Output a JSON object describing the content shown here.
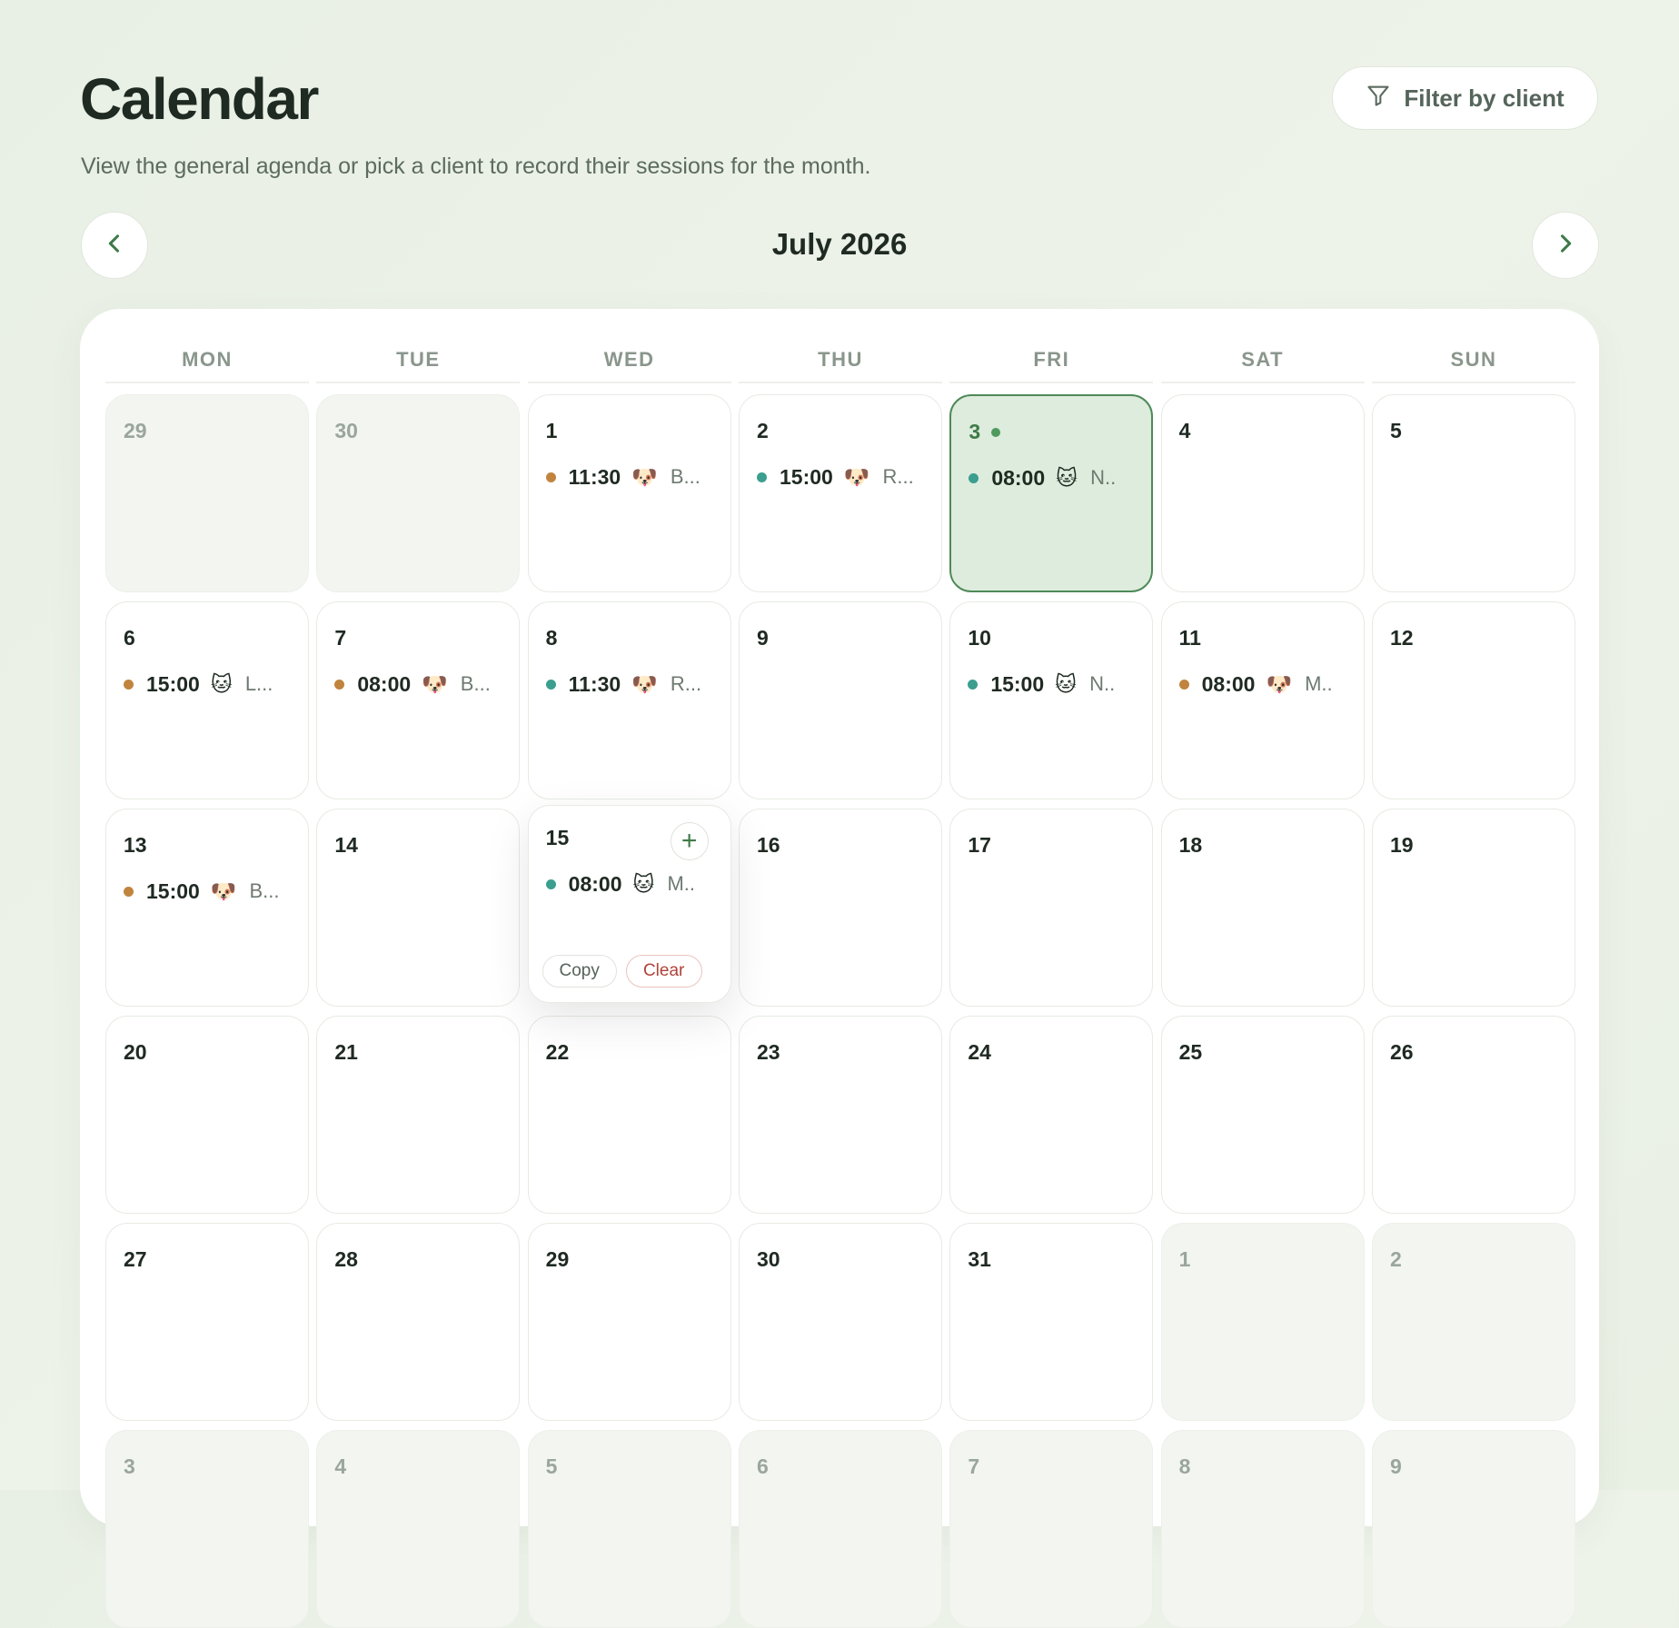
{
  "header": {
    "title": "Calendar",
    "subtitle": "View the general agenda or pick a client to record their sessions for the month.",
    "filter_label": "Filter by client",
    "filter_icon": "filter-funnel-icon"
  },
  "navigation": {
    "month": "July 2026",
    "prev_icon": "chevron-left-icon",
    "next_icon": "chevron-right-icon"
  },
  "colors": {
    "accent": "#4e8a58",
    "today_bg": "#ddecdc",
    "session_amber": "#c0843e",
    "session_teal": "#3b9e8f",
    "clear_red": "#b0433a"
  },
  "weekdays": [
    "MON",
    "TUE",
    "WED",
    "THU",
    "FRI",
    "SAT",
    "SUN"
  ],
  "day_actions": {
    "add": "+",
    "copy": "Copy",
    "clear": "Clear"
  },
  "weeks": [
    [
      {
        "num": "29",
        "out": true
      },
      {
        "num": "30",
        "out": true
      },
      {
        "num": "1",
        "sessions": [
          {
            "time": "11:30",
            "pet": "🐶",
            "client": "B...",
            "color": "amber"
          }
        ]
      },
      {
        "num": "2",
        "sessions": [
          {
            "time": "15:00",
            "pet": "🐶",
            "client": "R...",
            "color": "teal"
          }
        ]
      },
      {
        "num": "3",
        "today": true,
        "sessions": [
          {
            "time": "08:00",
            "pet": "🐱",
            "client": "N..",
            "color": "teal"
          }
        ]
      },
      {
        "num": "4"
      },
      {
        "num": "5"
      }
    ],
    [
      {
        "num": "6",
        "sessions": [
          {
            "time": "15:00",
            "pet": "🐱",
            "client": "L...",
            "color": "amber"
          }
        ]
      },
      {
        "num": "7",
        "sessions": [
          {
            "time": "08:00",
            "pet": "🐶",
            "client": "B...",
            "color": "amber"
          }
        ]
      },
      {
        "num": "8",
        "sessions": [
          {
            "time": "11:30",
            "pet": "🐶",
            "client": "R...",
            "color": "teal"
          }
        ]
      },
      {
        "num": "9"
      },
      {
        "num": "10",
        "sessions": [
          {
            "time": "15:00",
            "pet": "🐱",
            "client": "N..",
            "color": "teal"
          }
        ]
      },
      {
        "num": "11",
        "sessions": [
          {
            "time": "08:00",
            "pet": "🐶",
            "client": "M..",
            "color": "amber"
          }
        ]
      },
      {
        "num": "12"
      }
    ],
    [
      {
        "num": "13",
        "sessions": [
          {
            "time": "15:00",
            "pet": "🐶",
            "client": "B...",
            "color": "amber"
          }
        ]
      },
      {
        "num": "14"
      },
      {
        "num": "15",
        "hover": true,
        "sessions": [
          {
            "time": "08:00",
            "pet": "🐱",
            "client": "M..",
            "color": "teal"
          }
        ]
      },
      {
        "num": "16"
      },
      {
        "num": "17"
      },
      {
        "num": "18"
      },
      {
        "num": "19"
      }
    ],
    [
      {
        "num": "20"
      },
      {
        "num": "21"
      },
      {
        "num": "22"
      },
      {
        "num": "23"
      },
      {
        "num": "24"
      },
      {
        "num": "25"
      },
      {
        "num": "26"
      }
    ],
    [
      {
        "num": "27"
      },
      {
        "num": "28"
      },
      {
        "num": "29"
      },
      {
        "num": "30"
      },
      {
        "num": "31"
      },
      {
        "num": "1",
        "out": true
      },
      {
        "num": "2",
        "out": true
      }
    ],
    [
      {
        "num": "3",
        "out": true
      },
      {
        "num": "4",
        "out": true
      },
      {
        "num": "5",
        "out": true
      },
      {
        "num": "6",
        "out": true
      },
      {
        "num": "7",
        "out": true
      },
      {
        "num": "8",
        "out": true
      },
      {
        "num": "9",
        "out": true
      }
    ]
  ]
}
